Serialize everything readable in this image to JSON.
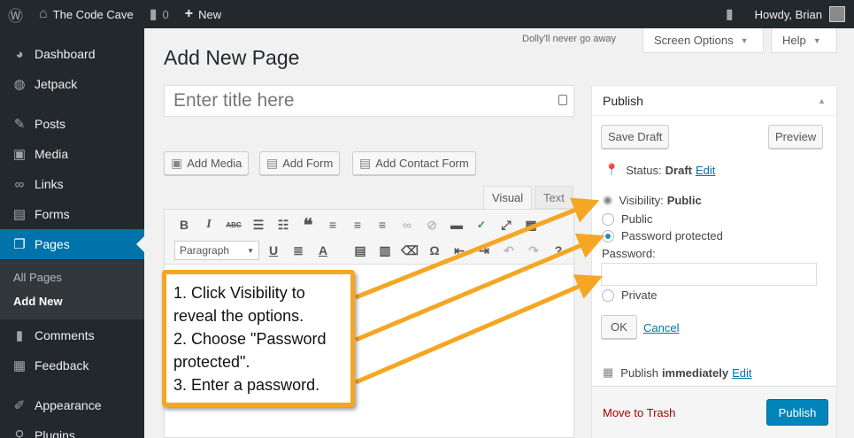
{
  "adminbar": {
    "site_name": "The Code Cave",
    "comments_count": "0",
    "new_label": "New",
    "howdy": "Howdy, Brian",
    "icons": {
      "wp": "wordpress-icon",
      "home": "home-icon",
      "comments": "comment-icon",
      "plus": "plus-icon",
      "notify": "notification-icon"
    }
  },
  "sidebar": {
    "items": [
      {
        "label": "Dashboard",
        "icon": "dashboard-icon"
      },
      {
        "label": "Jetpack",
        "icon": "jetpack-icon"
      },
      {
        "label": "Posts",
        "icon": "pushpin-icon"
      },
      {
        "label": "Media",
        "icon": "media-icon"
      },
      {
        "label": "Links",
        "icon": "link-icon"
      },
      {
        "label": "Forms",
        "icon": "forms-icon"
      },
      {
        "label": "Pages",
        "icon": "pages-icon"
      },
      {
        "label": "Comments",
        "icon": "comment-icon"
      },
      {
        "label": "Feedback",
        "icon": "feedback-icon"
      },
      {
        "label": "Appearance",
        "icon": "appearance-icon"
      },
      {
        "label": "Plugins",
        "icon": "plugins-icon"
      }
    ],
    "submenu": [
      "All Pages",
      "Add New"
    ]
  },
  "header": {
    "dolly": "Dolly'll never go away",
    "screen_options": "Screen Options",
    "help": "Help"
  },
  "main": {
    "page_title": "Add New Page",
    "title_placeholder": "Enter title here",
    "media_buttons": [
      "Add Media",
      "Add Form",
      "Add Contact Form"
    ],
    "tabs": [
      "Visual",
      "Text"
    ],
    "format_select": "Paragraph"
  },
  "publish": {
    "title": "Publish",
    "save_draft": "Save Draft",
    "preview": "Preview",
    "status_label": "Status:",
    "status_value": "Draft",
    "edit": "Edit",
    "visibility_label": "Visibility:",
    "visibility_value": "Public",
    "options": [
      "Public",
      "Password protected",
      "Private"
    ],
    "password_label": "Password:",
    "ok": "OK",
    "cancel": "Cancel",
    "publish_label": "Publish",
    "publish_value": "immediately",
    "trash": "Move to Trash",
    "publish_button": "Publish"
  },
  "callout": {
    "lines": [
      "1. Click Visibility to reveal the options.",
      "2. Choose \"Password protected\".",
      "3. Enter a password."
    ]
  },
  "colors": {
    "accent": "#0073aa",
    "callout": "#f5a623",
    "adminbar": "#23282d"
  }
}
